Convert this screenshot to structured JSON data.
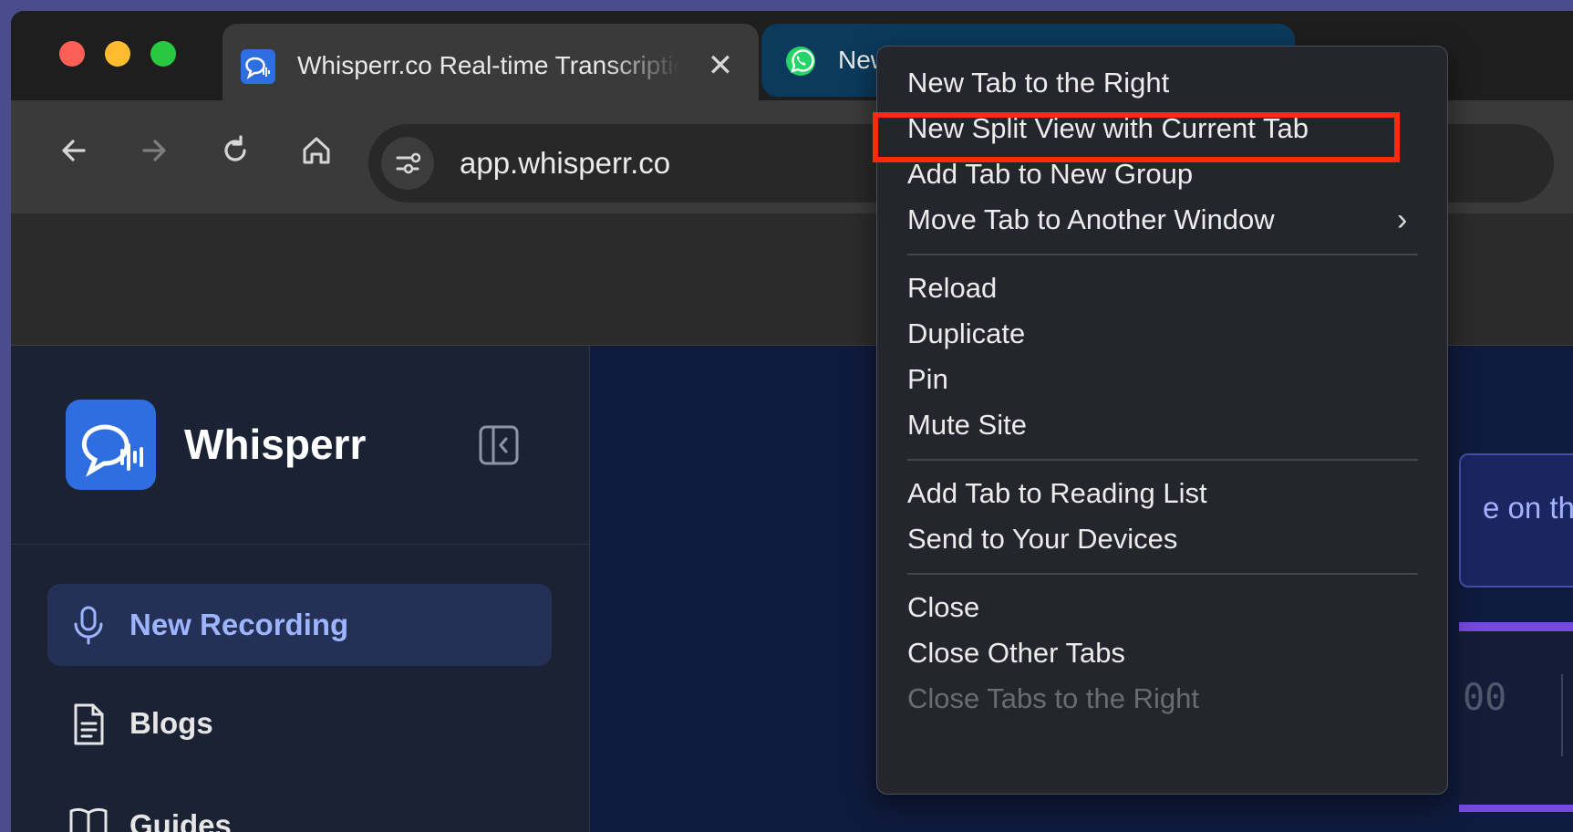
{
  "browser": {
    "active_tab": {
      "title": "Whisperr.co Real-time Transcription",
      "close_glyph": "✕"
    },
    "second_tab": {
      "title": "New"
    },
    "address_bar": {
      "url": "app.whisperr.co"
    }
  },
  "sidebar": {
    "brand": "Whisperr",
    "items": [
      {
        "label": "New Recording",
        "icon": "microphone-icon",
        "active": true
      },
      {
        "label": "Blogs",
        "icon": "document-icon"
      },
      {
        "label": "Guides",
        "icon": "book-icon"
      }
    ]
  },
  "main": {
    "banner_text": "e on the",
    "timer_text": "00"
  },
  "context_menu": {
    "items": [
      {
        "label": "New Tab to the Right"
      },
      {
        "label": "New Split View with Current Tab",
        "highlighted": true
      },
      {
        "label": "Add Tab to New Group"
      },
      {
        "label": "Move Tab to Another Window",
        "submenu": true
      },
      {
        "label": "Reload"
      },
      {
        "label": "Duplicate"
      },
      {
        "label": "Pin"
      },
      {
        "label": "Mute Site"
      },
      {
        "label": "Add Tab to Reading List"
      },
      {
        "label": "Send to Your Devices"
      },
      {
        "label": "Close"
      },
      {
        "label": "Close Other Tabs"
      },
      {
        "label": "Close Tabs to the Right",
        "disabled": true
      }
    ],
    "submenu_arrow": "›"
  },
  "colors": {
    "highlight": "#ff2a0a",
    "accent": "#2f6ee0",
    "active_nav_text": "#9db4ff",
    "progress": "#7648e8"
  }
}
